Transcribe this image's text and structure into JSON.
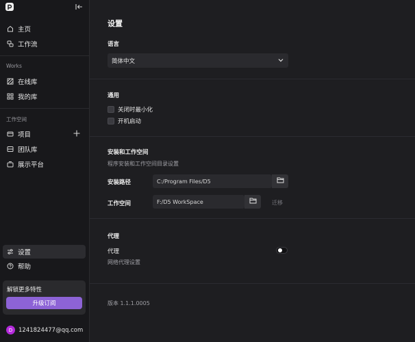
{
  "sidebar": {
    "nav_top": [
      {
        "label": "主页",
        "icon": "home-icon"
      },
      {
        "label": "工作流",
        "icon": "workflow-icon"
      }
    ],
    "works_label": "Works",
    "works_items": [
      {
        "label": "在线库",
        "icon": "online-library-icon"
      },
      {
        "label": "我的库",
        "icon": "my-library-icon"
      }
    ],
    "workspace_label": "工作空间",
    "workspace_items": [
      {
        "label": "项目",
        "icon": "project-icon"
      },
      {
        "label": "团队库",
        "icon": "team-library-icon"
      },
      {
        "label": "展示平台",
        "icon": "showcase-icon"
      }
    ],
    "bottom_items": [
      {
        "label": "设置",
        "icon": "settings-icon"
      },
      {
        "label": "帮助",
        "icon": "help-icon"
      }
    ],
    "upgrade": {
      "title": "解锁更多特性",
      "button": "升级订阅",
      "button_color": "#8d63d6"
    },
    "user": {
      "avatar_letter": "D",
      "email": "1241824477@qq.com",
      "avatar_color": "#b42adb"
    }
  },
  "main": {
    "title": "设置",
    "language": {
      "heading": "语言",
      "selected": "简体中文"
    },
    "general": {
      "heading": "通用",
      "options": [
        "关闭时最小化",
        "开机启动"
      ]
    },
    "install": {
      "heading": "安装和工作空间",
      "description": "程序安装和工作空间目录设置",
      "install_path_label": "安装路径",
      "install_path_value": "C:/Program Files/D5",
      "workspace_label": "工作空间",
      "workspace_value": "F:/D5 WorkSpace",
      "migrate_label": "迁移"
    },
    "proxy": {
      "heading": "代理",
      "label": "代理",
      "description": "网络代理设置",
      "enabled": false
    },
    "version": "版本 1.1.1.0005"
  }
}
